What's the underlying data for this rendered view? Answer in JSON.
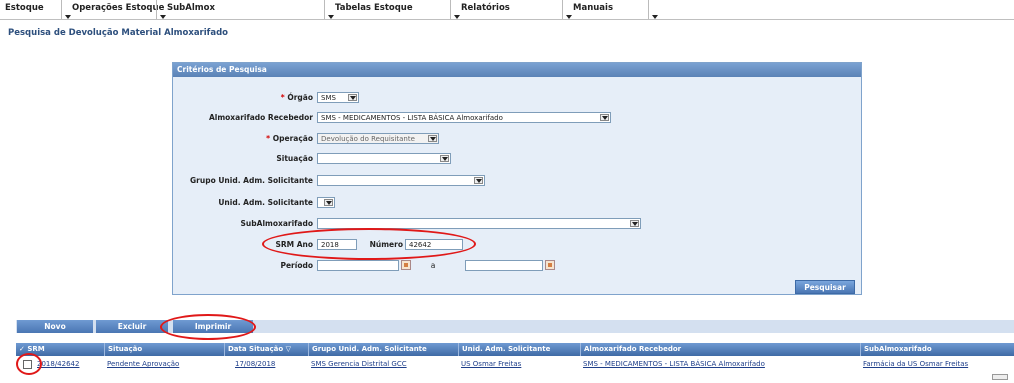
{
  "menu": [
    {
      "label": "Estoque"
    },
    {
      "label": "Operações Estoque"
    },
    {
      "label": "SubAlmox"
    },
    {
      "label": "Tabelas Estoque"
    },
    {
      "label": "Relatórios"
    },
    {
      "label": "Manuais"
    }
  ],
  "page_title": "Pesquisa de Devolução Material Almoxarifado",
  "panel": {
    "header": "Critérios de Pesquisa",
    "orgao": {
      "label": "Órgão",
      "value": "SMS"
    },
    "almox_recebedor": {
      "label": "Almoxarifado Recebedor",
      "value": "SMS - MEDICAMENTOS - LISTA BÁSICA Almoxarifado"
    },
    "operacao": {
      "label": "Operação",
      "value": "Devolução do Requisitante"
    },
    "situacao": {
      "label": "Situação",
      "value": ""
    },
    "grupo_unid": {
      "label": "Grupo Unid. Adm. Solicitante",
      "value": ""
    },
    "unid_adm": {
      "label": "Unid. Adm. Solicitante",
      "value": ""
    },
    "subalmox": {
      "label": "SubAlmoxarifado",
      "value": ""
    },
    "srm_ano": {
      "label": "SRM Ano",
      "value": "2018"
    },
    "numero": {
      "label": "Número",
      "value": "42642"
    },
    "periodo": {
      "label": "Período",
      "from": "",
      "to": "",
      "separator": "a"
    },
    "search_button": "Pesquisar",
    "required_mark": "*"
  },
  "actions": {
    "novo": "Novo",
    "excluir": "Excluir",
    "imprimir": "Imprimir"
  },
  "table": {
    "columns": [
      "SRM",
      "Situação",
      "Data Situação",
      "Grupo Unid. Adm. Solicitante",
      "Unid. Adm. Solicitante",
      "Almoxarifado Recebedor",
      "SubAlmoxarifado"
    ],
    "rows": [
      {
        "srm": "2018/42642",
        "situacao": "Pendente Aprovação",
        "data": "17/08/2018",
        "grupo": "SMS Gerencia Distrital GCC",
        "unid": "US Osmar Freitas",
        "almox": "SMS - MEDICAMENTOS - LISTA BÁSICA Almoxarifado",
        "sub": "Farmácia da US Osmar Freitas"
      }
    ]
  },
  "colors": {
    "accent": "#4a76b3",
    "highlight": "#e01818",
    "panel_bg": "#e6eef8",
    "title": "#2d4f7d"
  }
}
